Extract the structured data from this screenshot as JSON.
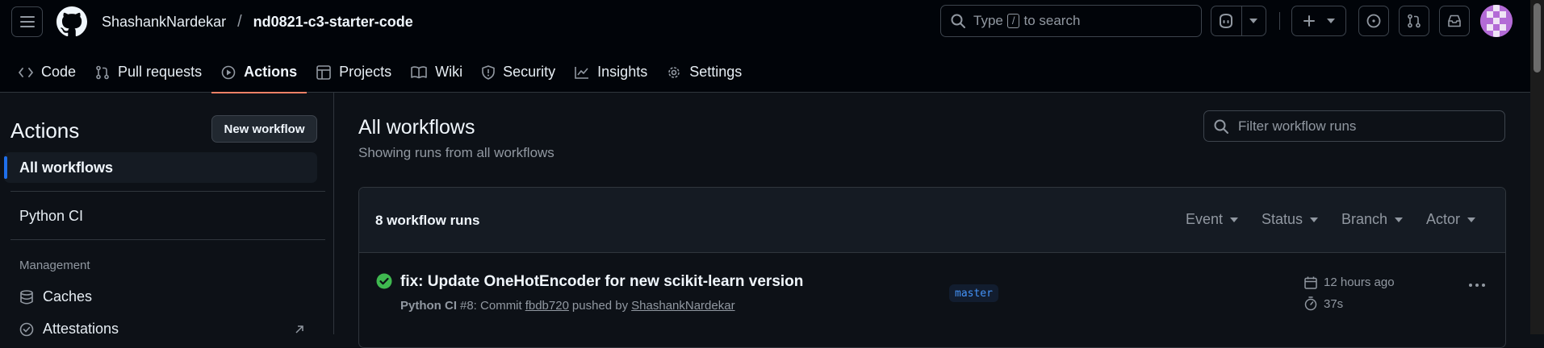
{
  "header": {
    "owner": "ShashankNardekar",
    "separator": "/",
    "repo": "nd0821-c3-starter-code",
    "search": {
      "prefix": "Type",
      "key": "/",
      "suffix": "to search"
    }
  },
  "tabs": [
    {
      "label": "Code",
      "icon": "code-icon"
    },
    {
      "label": "Pull requests",
      "icon": "git-pull-request-icon"
    },
    {
      "label": "Actions",
      "icon": "play-icon",
      "active": true
    },
    {
      "label": "Projects",
      "icon": "table-icon"
    },
    {
      "label": "Wiki",
      "icon": "book-icon"
    },
    {
      "label": "Security",
      "icon": "shield-icon"
    },
    {
      "label": "Insights",
      "icon": "graph-icon"
    },
    {
      "label": "Settings",
      "icon": "gear-icon"
    }
  ],
  "sidebar": {
    "title": "Actions",
    "new_workflow": "New workflow",
    "items": [
      {
        "label": "All workflows",
        "active": true
      },
      {
        "label": "Python CI"
      }
    ],
    "management_heading": "Management",
    "management_links": [
      {
        "label": "Caches",
        "icon": "database-icon"
      },
      {
        "label": "Attestations",
        "icon": "verified-icon"
      }
    ]
  },
  "main": {
    "title": "All workflows",
    "subtitle": "Showing runs from all workflows",
    "filter_placeholder": "Filter workflow runs",
    "runs_count": "8 workflow runs",
    "filters": [
      "Event",
      "Status",
      "Branch",
      "Actor"
    ],
    "runs": [
      {
        "title": "fix: Update OneHotEncoder for new scikit-learn version",
        "workflow": "Python CI",
        "run_number": "#8: Commit",
        "commit": "fbdb720",
        "pushed_by": "pushed by",
        "actor": "ShashankNardekar",
        "branch": "master",
        "time": "12 hours ago",
        "duration": "37s",
        "status": "success"
      }
    ]
  },
  "colors": {
    "accent_underline": "#f78166",
    "active_indicator": "#1f6feb",
    "success": "#3fb950",
    "link": "#4493f8"
  }
}
